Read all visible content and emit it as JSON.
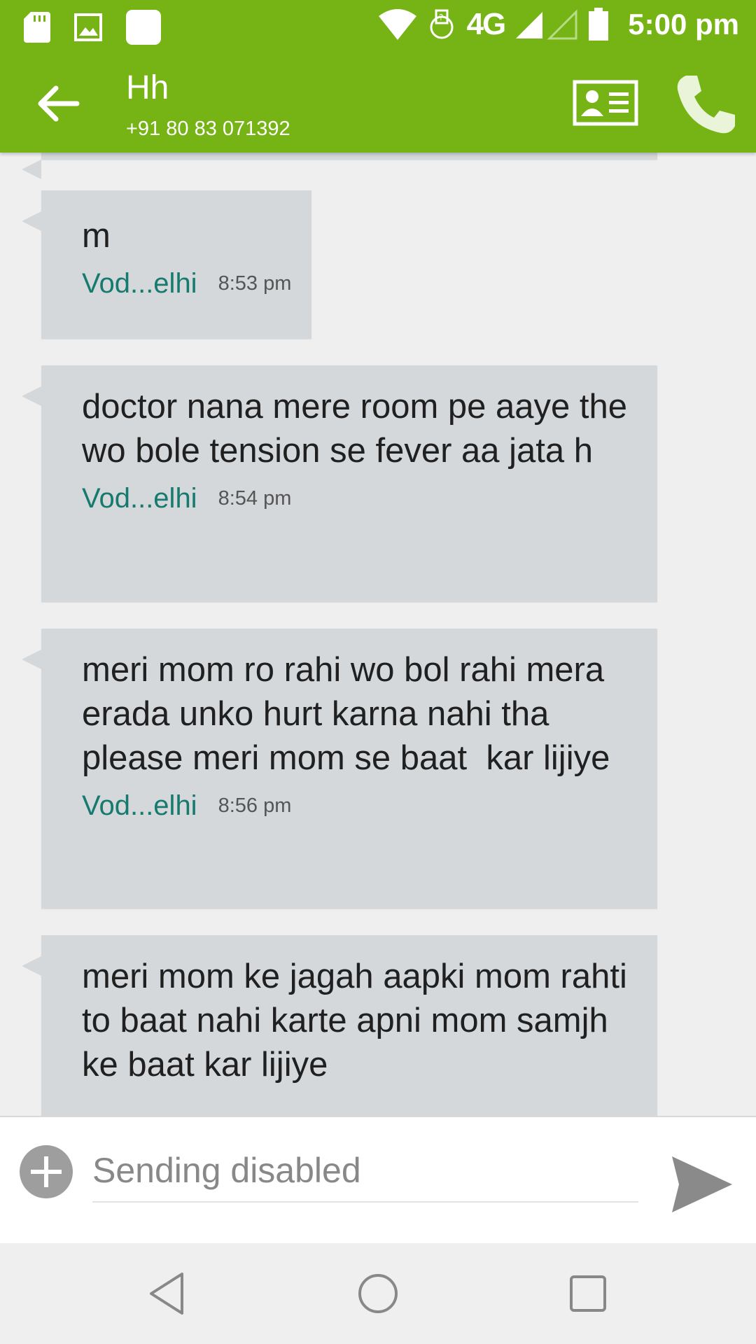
{
  "status_bar": {
    "network": "4G",
    "time": "5:00 pm",
    "left_icons": [
      "sd-card-icon",
      "image-icon",
      "app-square-icon"
    ],
    "right_icons": [
      "wifi-icon",
      "data-transfer-icon",
      "signal-icon",
      "battery-icon"
    ]
  },
  "header": {
    "title": "Hh",
    "subtitle": "+91 80 83 071392",
    "icons": [
      "back-arrow-icon",
      "contact-card-icon",
      "phone-icon"
    ]
  },
  "messages": [
    {
      "text": "m",
      "sender": "Vod...elhi",
      "time": "8:53 pm"
    },
    {
      "text": "doctor nana mere room pe aaye the wo bole tension se fever aa jata h",
      "sender": "Vod...elhi",
      "time": "8:54 pm"
    },
    {
      "text": "meri mom ro rahi wo bol rahi mera erada unko hurt karna nahi tha please meri mom se baat  kar lijiye",
      "sender": "Vod...elhi",
      "time": "8:56 pm"
    },
    {
      "text": "meri mom ke jagah aapki mom rahti to baat nahi karte apni mom samjh ke baat kar lijiye",
      "sender": "",
      "time": ""
    }
  ],
  "composer": {
    "placeholder": "Sending disabled",
    "icons": [
      "add-attachment-icon",
      "send-icon"
    ]
  },
  "nav_bar": {
    "icons": [
      "nav-back-icon",
      "nav-home-icon",
      "nav-recents-icon"
    ]
  },
  "colors": {
    "accent": "#76b314",
    "bubble": "#d5d8db",
    "sender_text": "#167a6e",
    "background": "#efefef"
  }
}
